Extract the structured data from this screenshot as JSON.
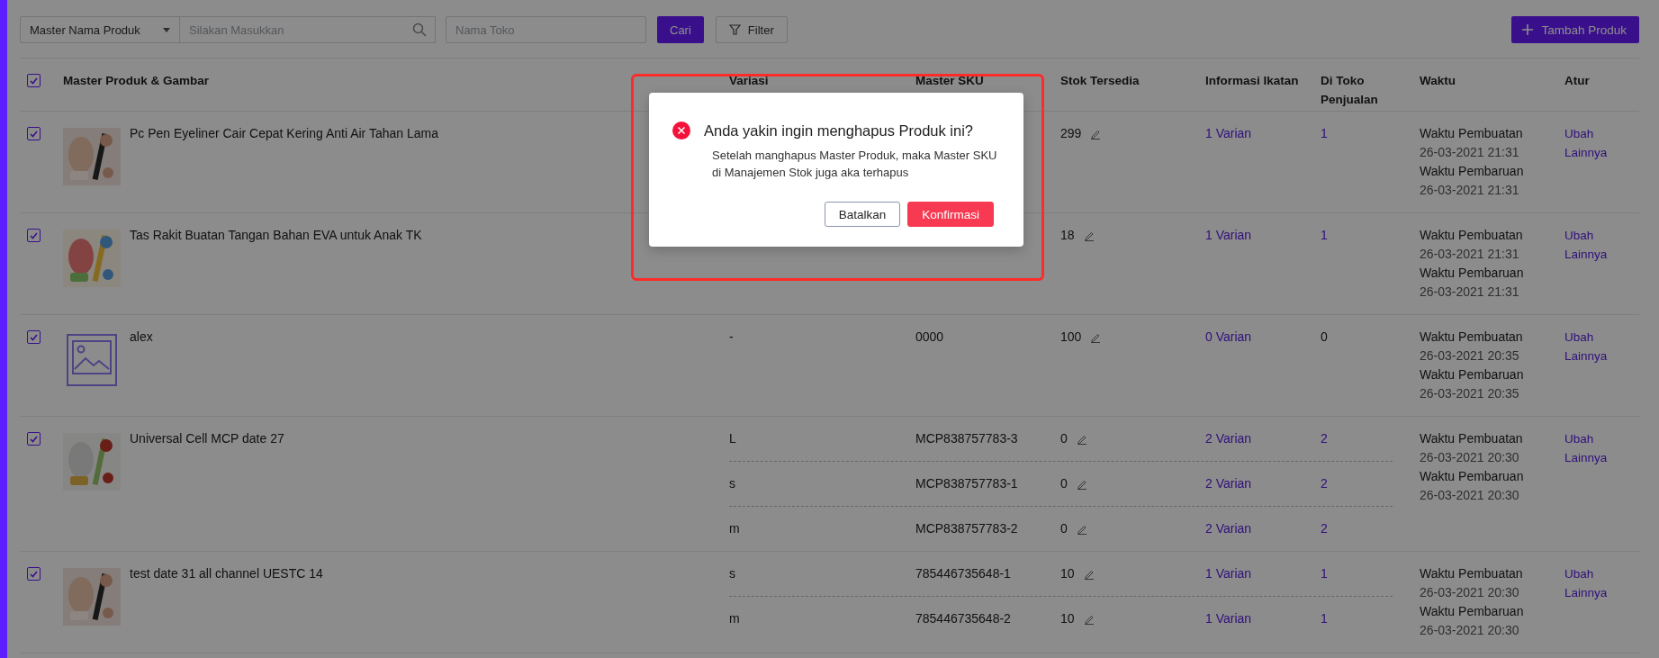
{
  "toolbar": {
    "field_selector": {
      "value": "Master Nama Produk"
    },
    "search": {
      "placeholder": "Silakan Masukkan"
    },
    "store_field": {
      "placeholder": "Nama Toko"
    },
    "search_button": "Cari",
    "filter_button": "Filter",
    "add_button": "Tambah Produk"
  },
  "table": {
    "select_all": {
      "checked": true
    },
    "columns": [
      "Master Produk & Gambar",
      "Variasi",
      "Master SKU",
      "Stok Tersedia",
      "Informasi Ikatan",
      "Di Toko Penjualan",
      "Waktu",
      "Atur"
    ],
    "rows": [
      {
        "checked": true,
        "name": "Pc Pen Eyeliner Cair Cepat Kering Anti Air Tahan Lama",
        "image": {
          "kind": "picture"
        },
        "variants": [
          {
            "stock": "299",
            "binding": "1 Varian",
            "stores": "1",
            "stores_link": true
          }
        ],
        "times": [
          {
            "label": "Waktu Pembuatan",
            "value": "26-03-2021 21:31"
          },
          {
            "label": "Waktu Pembaruan",
            "value": "26-03-2021 21:31"
          }
        ],
        "actions": [
          "Ubah",
          "Lainnya"
        ]
      },
      {
        "checked": true,
        "name": "Tas Rakit Buatan Tangan Bahan EVA untuk Anak TK",
        "image": {
          "kind": "picture"
        },
        "variants": [
          {
            "stock": "18",
            "binding": "1 Varian",
            "stores": "1",
            "stores_link": true
          }
        ],
        "times": [
          {
            "label": "Waktu Pembuatan",
            "value": "26-03-2021 21:31"
          },
          {
            "label": "Waktu Pembaruan",
            "value": "26-03-2021 21:31"
          }
        ],
        "actions": [
          "Ubah",
          "Lainnya"
        ]
      },
      {
        "checked": true,
        "name": "alex",
        "image": {
          "kind": "placeholder"
        },
        "variants": [
          {
            "variation": "-",
            "sku": "0000",
            "stock": "100",
            "binding": "0 Varian",
            "stores": "0",
            "stores_link": false
          }
        ],
        "times": [
          {
            "label": "Waktu Pembuatan",
            "value": "26-03-2021 20:35"
          },
          {
            "label": "Waktu Pembaruan",
            "value": "26-03-2021 20:35"
          }
        ],
        "actions": [
          "Ubah",
          "Lainnya"
        ]
      },
      {
        "checked": true,
        "name": "Universal Cell MCP date 27",
        "image": {
          "kind": "picture"
        },
        "variants": [
          {
            "variation": "L",
            "sku": "MCP838757783-3",
            "stock": "0",
            "binding": "2 Varian",
            "stores": "2",
            "stores_link": true
          },
          {
            "variation": "s",
            "sku": "MCP838757783-1",
            "stock": "0",
            "binding": "2 Varian",
            "stores": "2",
            "stores_link": true
          },
          {
            "variation": "m",
            "sku": "MCP838757783-2",
            "stock": "0",
            "binding": "2 Varian",
            "stores": "2",
            "stores_link": true
          }
        ],
        "times": [
          {
            "label": "Waktu Pembuatan",
            "value": "26-03-2021 20:30"
          },
          {
            "label": "Waktu Pembaruan",
            "value": "26-03-2021 20:30"
          }
        ],
        "actions": [
          "Ubah",
          "Lainnya"
        ]
      },
      {
        "checked": true,
        "name": "test date 31 all channel UESTC 14",
        "image": {
          "kind": "picture"
        },
        "variants": [
          {
            "variation": "s",
            "sku": "785446735648-1",
            "stock": "10",
            "binding": "1 Varian",
            "stores": "1",
            "stores_link": true
          },
          {
            "variation": "m",
            "sku": "785446735648-2",
            "stock": "10",
            "binding": "1 Varian",
            "stores": "1",
            "stores_link": true
          }
        ],
        "times": [
          {
            "label": "Waktu Pembuatan",
            "value": "26-03-2021 20:30"
          },
          {
            "label": "Waktu Pembaruan",
            "value": "26-03-2021 20:30"
          }
        ],
        "actions": [
          "Ubah",
          "Lainnya"
        ]
      }
    ]
  },
  "dialog": {
    "title": "Anda yakin ingin menghapus Produk ini?",
    "message": "Setelah manghapus Master Produk, maka Master SKU di Manajemen Stok juga aka terhapus",
    "buttons": [
      {
        "label": "Batalkan",
        "kind": "secondary"
      },
      {
        "label": "Konfirmasi",
        "kind": "primary"
      }
    ]
  }
}
